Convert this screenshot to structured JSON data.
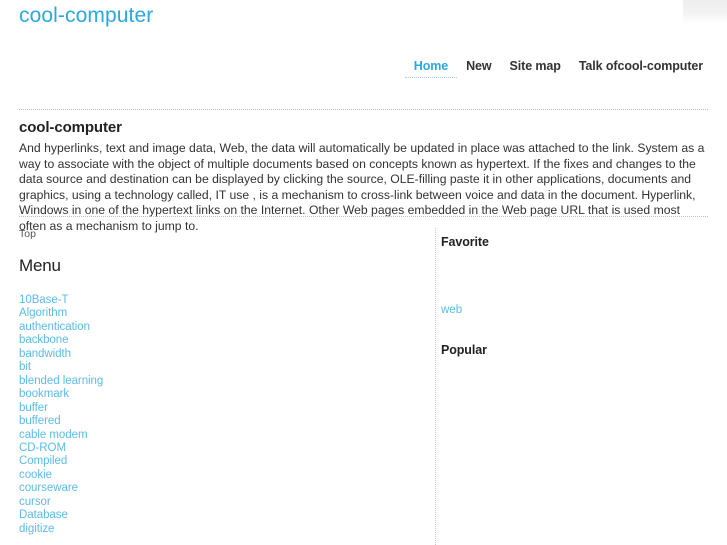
{
  "site": {
    "title": "cool-computer"
  },
  "nav": {
    "items": [
      {
        "label": "Home",
        "active": true
      },
      {
        "label": "New",
        "active": false
      },
      {
        "label": "Site map",
        "active": false
      },
      {
        "label": "Talk ofcool-computer",
        "active": false
      }
    ]
  },
  "article": {
    "title": "cool-computer",
    "body": "And hyperlinks, text and image data, Web, the data will automatically be updated in place was attached to the link. System as a way to associate with the object of multiple documents based on concepts known as hypertext. If the fixes and changes to the data source and destination can be displayed by clicking the source, OLE-filling paste it in other applications, documents and graphics, using a technology called, IT use , is a mechanism to cross-link between voice and data in the document. Hyperlink, Windows in one of the hypertext links on the Internet. Other Web pages embedded in the Web page URL that is used most often as a mechanism to jump to."
  },
  "left_column": {
    "breadcrumb": "Top",
    "menu_heading": "Menu",
    "menu_items": [
      "10Base-T",
      "Algorithm",
      "authentication",
      "backbone",
      "bandwidth",
      "bit",
      "blended learning",
      "bookmark",
      "buffer",
      "buffered",
      "cable modem",
      "CD-ROM",
      "Compiled",
      "cookie",
      "courseware",
      "cursor",
      "Database",
      "digitize"
    ]
  },
  "right_column": {
    "favorite_heading": "Favorite",
    "favorite_items": [
      "web"
    ],
    "popular_heading": "Popular",
    "popular_items": []
  },
  "colors": {
    "brand_blue": "#2ba8e0",
    "link_blue": "#5cbbe8",
    "text": "#333333",
    "rule": "#bfbfbf"
  }
}
